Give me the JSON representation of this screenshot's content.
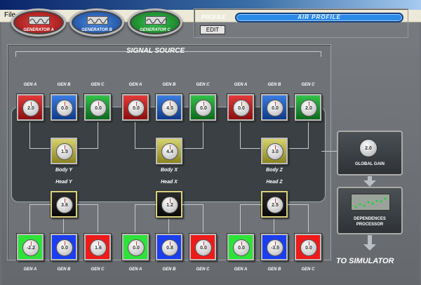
{
  "menu": {
    "file": "File"
  },
  "generators": [
    {
      "label": "GENERATOR A",
      "color": "#c02020"
    },
    {
      "label": "GENERATOR B",
      "color": "#2060c0"
    },
    {
      "label": "GENERATOR C",
      "color": "#20a030"
    }
  ],
  "profile": {
    "label": "PROFILE",
    "edit": "EDIT",
    "name": "AIR PROFILE"
  },
  "signal_source": {
    "title": "SIGNAL SOURCE",
    "gen_labels": [
      "GEN A",
      "GEN B",
      "GEN C"
    ],
    "top_groups": [
      {
        "values": [
          "2.0",
          "0.0",
          "0.0"
        ]
      },
      {
        "values": [
          "0.0",
          "4.5",
          "0.0"
        ]
      },
      {
        "values": [
          "0.0",
          "0.0",
          "2.0"
        ]
      }
    ],
    "body": [
      {
        "label": "Body Y",
        "value": "1.5"
      },
      {
        "label": "Body X",
        "value": "4.4"
      },
      {
        "label": "Body Z",
        "value": "3.0"
      }
    ],
    "head": [
      {
        "label": "Head Y",
        "value": "3.6"
      },
      {
        "label": "Head X",
        "value": "1.2"
      },
      {
        "label": "Head Z",
        "value": "2.5"
      }
    ],
    "bottom_groups": [
      {
        "values": [
          "-2.2",
          "0.0",
          "1.6"
        ]
      },
      {
        "values": [
          "0.0",
          "0.8",
          "0.0"
        ]
      },
      {
        "values": [
          "0.0",
          "-3.5",
          "0.0"
        ]
      }
    ]
  },
  "global_gain": {
    "label": "GLOBAL GAIN",
    "value": "2.0"
  },
  "dependences": {
    "label_line1": "DEPENDENCES",
    "label_line2": "PROCESSOR"
  },
  "to_simulator": "TO SIMULATOR"
}
